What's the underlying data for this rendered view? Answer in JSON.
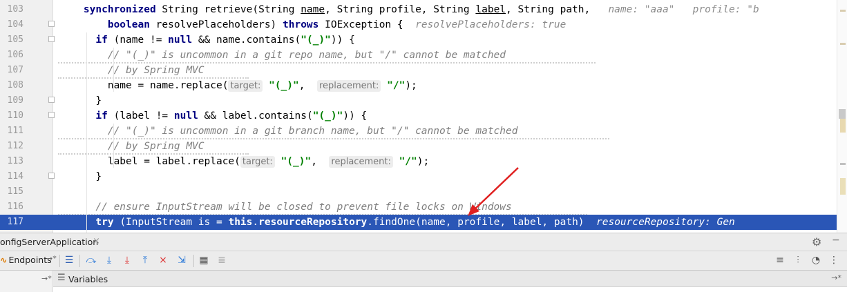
{
  "editor": {
    "lines": [
      {
        "num": "103",
        "parts": [
          [
            "    ",
            ""
          ],
          [
            "synchronized",
            "kw"
          ],
          [
            " String retrieve(String ",
            ""
          ],
          [
            "name",
            "ul"
          ],
          [
            ", String profile, String ",
            ""
          ],
          [
            "label",
            "ul"
          ],
          [
            ", String path,   ",
            ""
          ],
          [
            "name: \"aaa\"   profile: \"b",
            "hint-inline"
          ]
        ]
      },
      {
        "num": "104",
        "parts": [
          [
            "        ",
            ""
          ],
          [
            "boolean",
            "kw"
          ],
          [
            " resolvePlaceholders) ",
            ""
          ],
          [
            "throws",
            "kw"
          ],
          [
            " IOException {  ",
            ""
          ],
          [
            "resolvePlaceholders: true",
            "hint-inline"
          ]
        ]
      },
      {
        "num": "105",
        "parts": [
          [
            "      ",
            ""
          ],
          [
            "if",
            "kw"
          ],
          [
            " (name != ",
            ""
          ],
          [
            "null",
            "kw"
          ],
          [
            " && name.contains(",
            ""
          ],
          [
            "\"(_)\"",
            "str"
          ],
          [
            ")) {",
            ""
          ]
        ]
      },
      {
        "num": "106",
        "parts": [
          [
            "        ",
            ""
          ],
          [
            "// \"(_)\" is uncommon in a git repo name, but \"/\" cannot be matched",
            "cmt"
          ]
        ]
      },
      {
        "num": "107",
        "parts": [
          [
            "        ",
            ""
          ],
          [
            "// by Spring MVC",
            "cmt"
          ]
        ]
      },
      {
        "num": "108",
        "parts": [
          [
            "        name = name.replace(",
            ""
          ],
          [
            "target:",
            "param-hint"
          ],
          [
            " ",
            ""
          ],
          [
            "\"(_)\"",
            "str"
          ],
          [
            ",  ",
            ""
          ],
          [
            "replacement:",
            "param-hint"
          ],
          [
            " ",
            ""
          ],
          [
            "\"/\"",
            "str"
          ],
          [
            ");",
            ""
          ]
        ]
      },
      {
        "num": "109",
        "parts": [
          [
            "      }",
            ""
          ]
        ]
      },
      {
        "num": "110",
        "parts": [
          [
            "      ",
            ""
          ],
          [
            "if",
            "kw"
          ],
          [
            " (label != ",
            ""
          ],
          [
            "null",
            "kw"
          ],
          [
            " && label.contains(",
            ""
          ],
          [
            "\"(_)\"",
            "str"
          ],
          [
            ")) {",
            ""
          ]
        ]
      },
      {
        "num": "111",
        "parts": [
          [
            "        ",
            ""
          ],
          [
            "// \"(_)\" is uncommon in a git branch name, but \"/\" cannot be matched",
            "cmt"
          ]
        ]
      },
      {
        "num": "112",
        "parts": [
          [
            "        ",
            ""
          ],
          [
            "// by Spring MVC",
            "cmt"
          ]
        ]
      },
      {
        "num": "113",
        "parts": [
          [
            "        label = label.replace(",
            ""
          ],
          [
            "target:",
            "param-hint"
          ],
          [
            " ",
            ""
          ],
          [
            "\"(_)\"",
            "str"
          ],
          [
            ",  ",
            ""
          ],
          [
            "replacement:",
            "param-hint"
          ],
          [
            " ",
            ""
          ],
          [
            "\"/\"",
            "str"
          ],
          [
            ");",
            ""
          ]
        ]
      },
      {
        "num": "114",
        "parts": [
          [
            "      }",
            ""
          ]
        ]
      },
      {
        "num": "115",
        "parts": [
          [
            "",
            ""
          ]
        ]
      },
      {
        "num": "116",
        "parts": [
          [
            "      ",
            ""
          ],
          [
            "// ensure InputStream will be closed to prevent file locks on Windows",
            "cmt"
          ]
        ]
      },
      {
        "num": "117",
        "parts": [
          [
            "      ",
            ""
          ],
          [
            "try",
            "kw"
          ],
          [
            " (InputStream is = ",
            ""
          ],
          [
            "this",
            "kw"
          ],
          [
            ".",
            ""
          ],
          [
            "resourceRepository",
            "kw"
          ],
          [
            ".findOne(name, profile, label, path)  ",
            ""
          ],
          [
            "resourceRepository: Gen",
            "hint-inline"
          ]
        ]
      }
    ]
  },
  "debug": {
    "tab_title": "onfigServerApplication",
    "tab_close": "×",
    "endpoints_label": "Endpoints",
    "endpoints_symbol": "∿",
    "pin_symbol": "→*",
    "variables_label": "Variables"
  },
  "icons": {
    "gear": "⚙",
    "minimize": "−",
    "menu": "☰",
    "step_over": "⤼",
    "step_into": "⤓",
    "force_step_into": "⤓",
    "step_out": "⤒",
    "drop_frame": "⨯",
    "run_to_cursor": "⇲",
    "evaluate": "▦",
    "trace": "≣",
    "restore_layout": "≡",
    "settings2": "⫶",
    "dashboard": "◔",
    "more": "⋮"
  },
  "colors": {
    "current_line": "#2a56b6",
    "keyword": "#000080",
    "string": "#008000",
    "comment": "#808080",
    "arrow": "#e02020"
  }
}
